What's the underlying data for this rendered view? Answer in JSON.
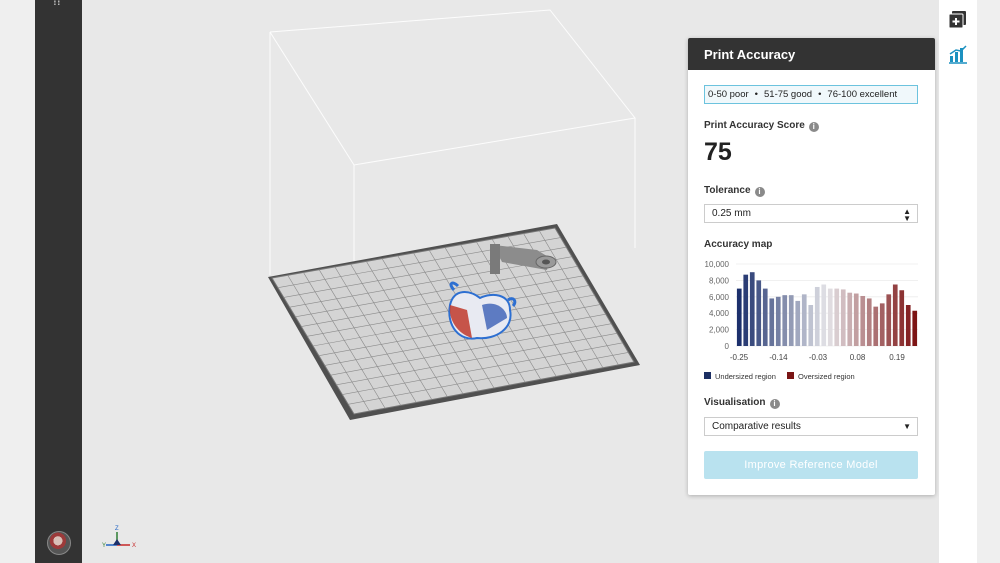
{
  "sidebar": {
    "menu_glyph": "⁞⁞"
  },
  "viewport": {
    "axis_labels": {
      "x": "X",
      "y": "Y",
      "z": "Z"
    }
  },
  "toolbar": {
    "icons": [
      "add-model-icon",
      "analytics-icon"
    ]
  },
  "panel": {
    "title": "Print Accuracy",
    "legend": {
      "poor": "0-50 poor",
      "good": "51-75 good",
      "excellent": "76-100 excellent",
      "separator": "•"
    },
    "score_label": "Print Accuracy Score",
    "score_value": "75",
    "tolerance_label": "Tolerance",
    "tolerance_value": "0.25 mm",
    "accuracy_map_label": "Accuracy map",
    "visualisation_label": "Visualisation",
    "visualisation_value": "Comparative results",
    "improve_button": "Improve Reference Model",
    "info_glyph": "i"
  },
  "colors": {
    "undersized": "#1c2f63",
    "oversized": "#7a1515",
    "accent": "#6cc3de",
    "sidebar": "#333333"
  },
  "chart_data": {
    "type": "bar",
    "yticks": [
      "10,000",
      "8,000",
      "6,000",
      "4,000",
      "2,000",
      "0"
    ],
    "ylim": [
      0,
      10000
    ],
    "xticks": [
      "-0.25",
      "-0.14",
      "-0.03",
      "0.08",
      "0.19"
    ],
    "values": [
      7000,
      8700,
      9000,
      8000,
      7000,
      5800,
      6000,
      6200,
      6200,
      5500,
      6300,
      5000,
      7200,
      7500,
      7000,
      7000,
      6900,
      6500,
      6400,
      6100,
      5800,
      4800,
      5200,
      6300,
      7500,
      6800,
      5000,
      4300
    ],
    "legend": [
      {
        "name": "Undersized region",
        "color": "#1c2f63"
      },
      {
        "name": "Oversized region",
        "color": "#7a1515"
      }
    ]
  }
}
